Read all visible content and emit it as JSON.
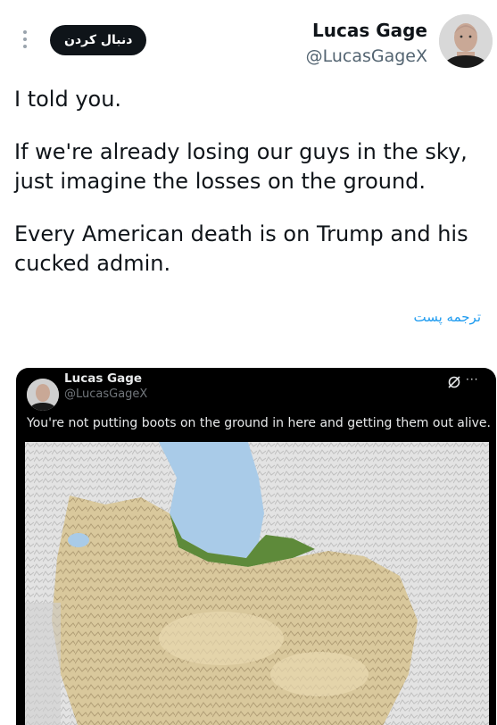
{
  "header": {
    "name": "Lucas Gage",
    "handle": "@LucasGageX",
    "follow_label": "دنبال کردن",
    "more_icon": "vertical-dots-icon"
  },
  "tweet": {
    "line1": "I told you.",
    "line2a": "If we're already losing our guys in the sky,",
    "line2b": "just imagine the losses on the ground.",
    "line3a": "Every American death is on Trump and his",
    "line3b": "cucked admin.",
    "translate_label": "ترجمه پست"
  },
  "embed": {
    "name": "Lucas Gage",
    "handle": "@LucasGageX",
    "more_label": "···",
    "text": "You're not putting boots on the ground in here and getting them out alive.",
    "image_subject": "shaded-relief map"
  },
  "colors": {
    "accent": "#1d9bf0",
    "text": "#0f1419",
    "muted": "#536471",
    "embed_bg": "#000000",
    "water": "#a9cbe8",
    "land": "#d9c89c",
    "coast_green": "#5e8a3a"
  }
}
